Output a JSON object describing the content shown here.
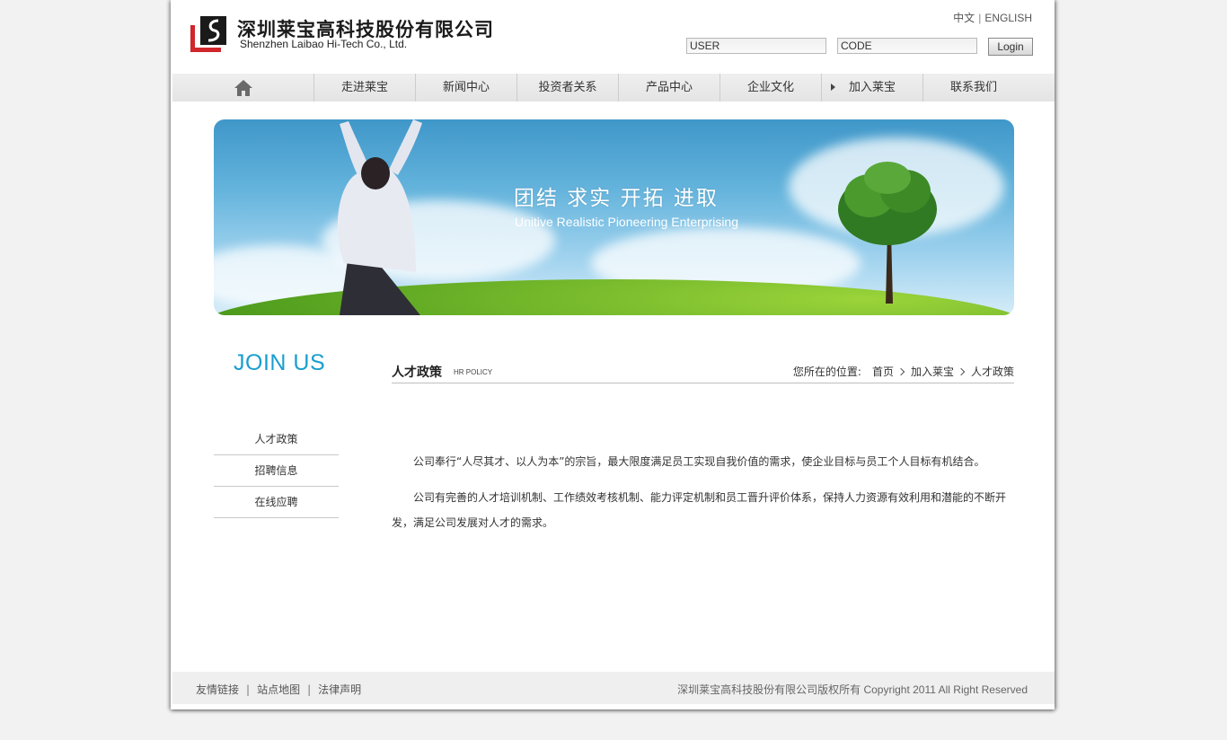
{
  "header": {
    "logo_cn": "深圳莱宝高科技股份有限公司",
    "logo_en": "Shenzhen Laibao Hi-Tech Co., Ltd.",
    "lang_cn": "中文",
    "lang_sep": "|",
    "lang_en": "ENGLISH",
    "user_placeholder": "USER",
    "code_placeholder": "CODE",
    "login_label": "Login"
  },
  "nav": {
    "items": [
      "走进莱宝",
      "新闻中心",
      "投资者关系",
      "产品中心",
      "企业文化",
      "加入莱宝",
      "联系我们"
    ]
  },
  "banner": {
    "slogan_cn": "团结  求实  开拓  进取",
    "slogan_en": "Unitive Realistic Pioneering Enterprising"
  },
  "sidebar": {
    "title": "JOIN US",
    "items": [
      "人才政策",
      "招聘信息",
      "在线应聘"
    ]
  },
  "content": {
    "title": "人才政策",
    "subtitle": "HR POLICY",
    "breadcrumb_label": "您所在的位置:",
    "breadcrumb": [
      "首页",
      "加入莱宝",
      "人才政策"
    ],
    "paragraphs": [
      "公司奉行“人尽其才、以人为本”的宗旨，最大限度满足员工实现自我价值的需求，使企业目标与员工个人目标有机结合。",
      "公司有完善的人才培训机制、工作绩效考核机制、能力评定机制和员工晋升评价体系，保持人力资源有效利用和潜能的不断开发，满足公司发展对人才的需求。"
    ]
  },
  "footer": {
    "links": [
      "友情链接",
      "站点地图",
      "法律声明"
    ],
    "sep": "|",
    "copyright": "深圳莱宝高科技股份有限公司版权所有 Copyright 2011 All Right Reserved"
  },
  "colors": {
    "accent": "#1a9ecf",
    "nav_bg": "#e8e8e8",
    "footer_bg": "#efefef",
    "logo_red": "#d0262c"
  }
}
